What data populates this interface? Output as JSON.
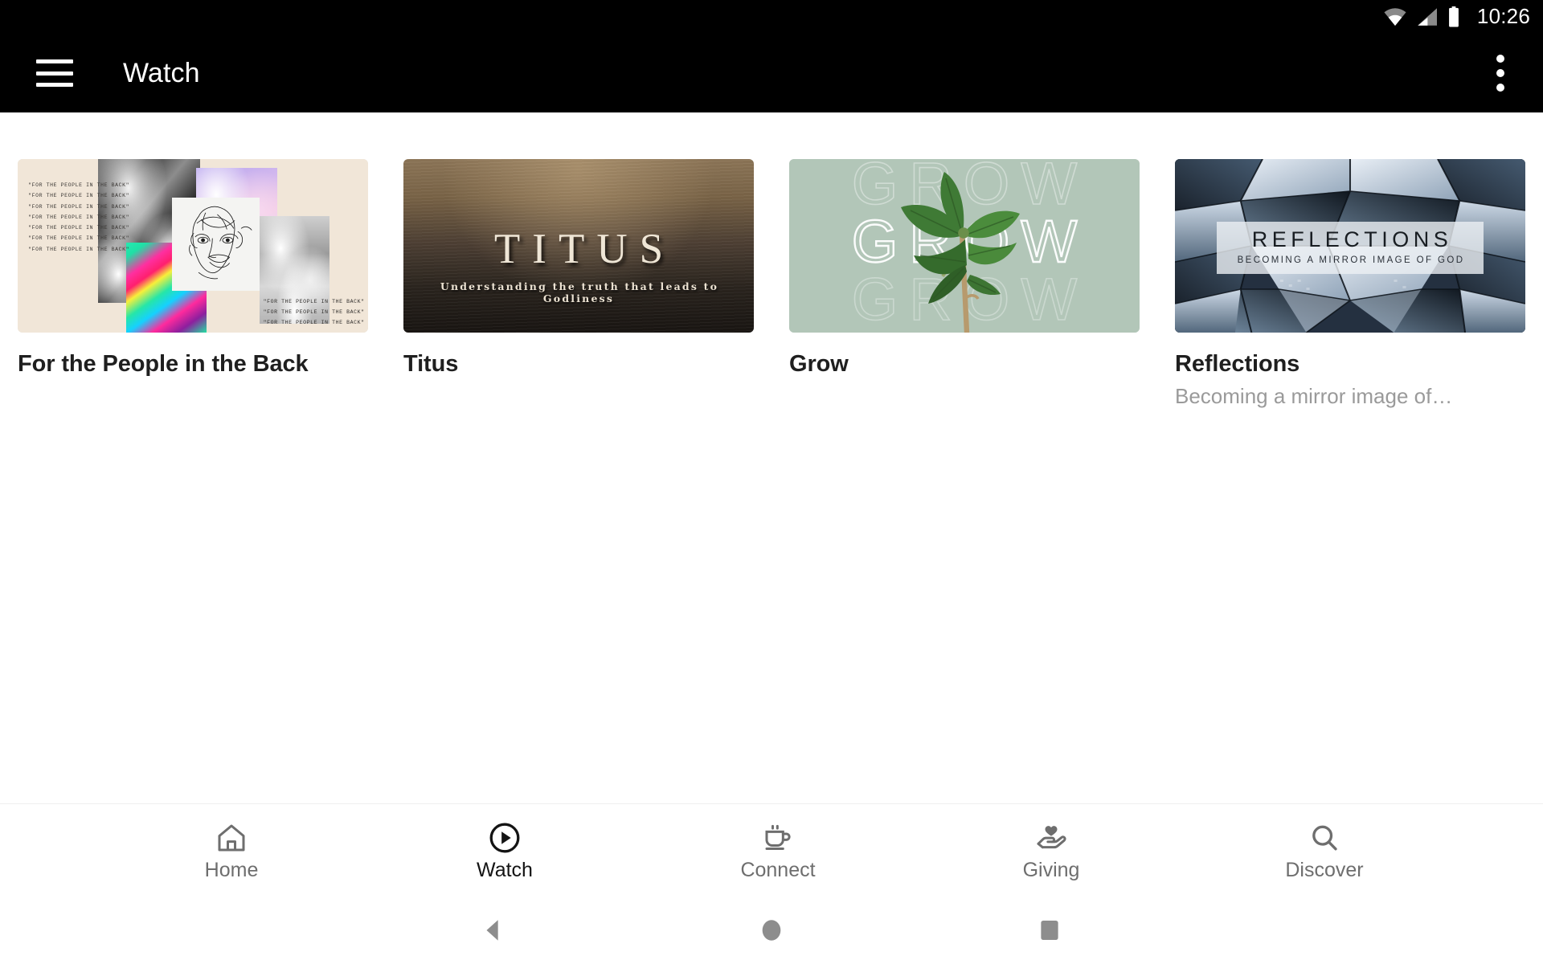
{
  "status_bar": {
    "time": "10:26",
    "icons": [
      "wifi-icon",
      "cellular-signal-icon",
      "battery-icon"
    ]
  },
  "app_bar": {
    "menu_icon": "hamburger-menu-icon",
    "title": "Watch",
    "overflow_icon": "more-vertical-icon",
    "background_color": "#000000",
    "text_color": "#ffffff"
  },
  "main": {
    "cards": [
      {
        "title": "For the People in the Back",
        "subtitle": "",
        "art": {
          "kind": "collage",
          "background_color": "#f1e6d8",
          "repeated_text": "\"FOR THE PEOPLE IN THE BACK\"",
          "text_lines_top": 7,
          "text_lines_bottom": 3
        }
      },
      {
        "title": "Titus",
        "subtitle": "",
        "art": {
          "kind": "titus-poster",
          "headline": "TITUS",
          "tagline": "Understanding the truth that leads to Godliness",
          "background_color": "#4e4034",
          "text_color": "#efe6d6"
        }
      },
      {
        "title": "Grow",
        "subtitle": "",
        "art": {
          "kind": "grow-poster",
          "word": "GROW",
          "repeat_rows": 3,
          "background_color": "#b2c6b8",
          "outline_color": "#ffffff"
        }
      },
      {
        "title": "Reflections",
        "subtitle": "Becoming a mirror image of…",
        "art": {
          "kind": "reflections-poster",
          "headline": "REFLECTIONS",
          "tagline": "BECOMING A MIRROR IMAGE OF GOD",
          "background_color": "#1d2733",
          "plate_color": "#ecf0f4"
        }
      }
    ]
  },
  "bottom_nav": {
    "active": "Watch",
    "items": [
      {
        "label": "Home",
        "icon": "home-icon",
        "active": false
      },
      {
        "label": "Watch",
        "icon": "play-circle-icon",
        "active": true
      },
      {
        "label": "Connect",
        "icon": "coffee-cup-icon",
        "active": false
      },
      {
        "label": "Giving",
        "icon": "hand-heart-icon",
        "active": false
      },
      {
        "label": "Discover",
        "icon": "search-icon",
        "active": false
      }
    ],
    "inactive_color": "#6e6e6e",
    "active_color": "#141414"
  },
  "system_nav": {
    "buttons": [
      {
        "name": "back-button",
        "icon": "triangle-left-icon"
      },
      {
        "name": "home-button",
        "icon": "circle-icon"
      },
      {
        "name": "recents-button",
        "icon": "square-icon"
      }
    ],
    "color": "#8d8d8d"
  }
}
